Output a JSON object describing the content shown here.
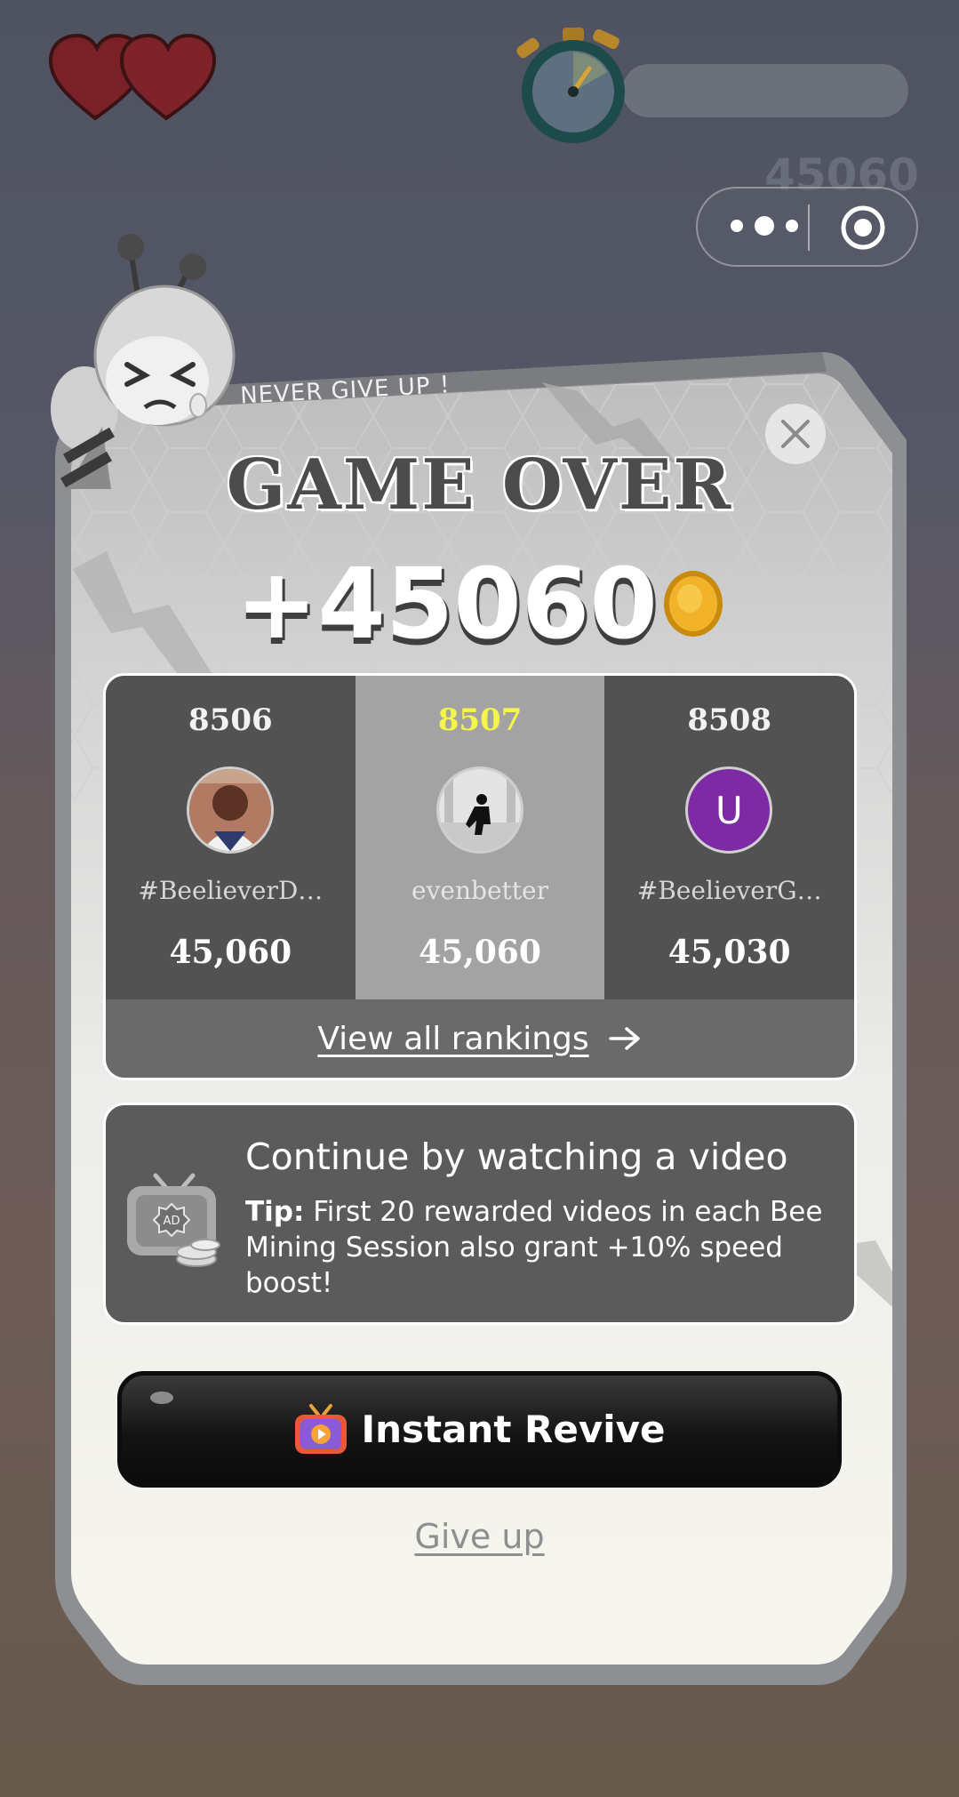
{
  "hud": {
    "lives_icon": "heart-icon",
    "timer_icon": "stopwatch-icon",
    "background_score": "45060"
  },
  "mini_program_menu": {
    "more_icon": "more-dots-icon",
    "close_icon": "target-close-icon"
  },
  "modal": {
    "banner": "NEVER GIVE UP ！",
    "title": "GAME OVER",
    "score": "+45060",
    "coin_icon": "coin-icon",
    "close_icon": "close-icon"
  },
  "rankings": {
    "entries": [
      {
        "rank": "8506",
        "name": "#BeelieverD…",
        "score": "45,060",
        "avatar": "photo"
      },
      {
        "rank": "8507",
        "name": "evenbetter",
        "score": "45,060",
        "avatar": "photo",
        "highlight": "#f4f44a"
      },
      {
        "rank": "8508",
        "name": "#BeelieverG…",
        "score": "45,030",
        "avatar_letter": "U",
        "avatar_color": "#7e2aa4"
      }
    ],
    "view_all": "View all rankings",
    "arrow_icon": "arrow-right-icon"
  },
  "continue": {
    "title": "Continue by watching a video",
    "tip_label": "Tip:",
    "tip_text": " First 20 rewarded videos in each Bee Mining Session also grant +10% speed boost!",
    "icon": "ad-tv-icon"
  },
  "actions": {
    "revive_label": "Instant Revive",
    "revive_icon": "video-play-icon",
    "give_up_label": "Give up"
  }
}
